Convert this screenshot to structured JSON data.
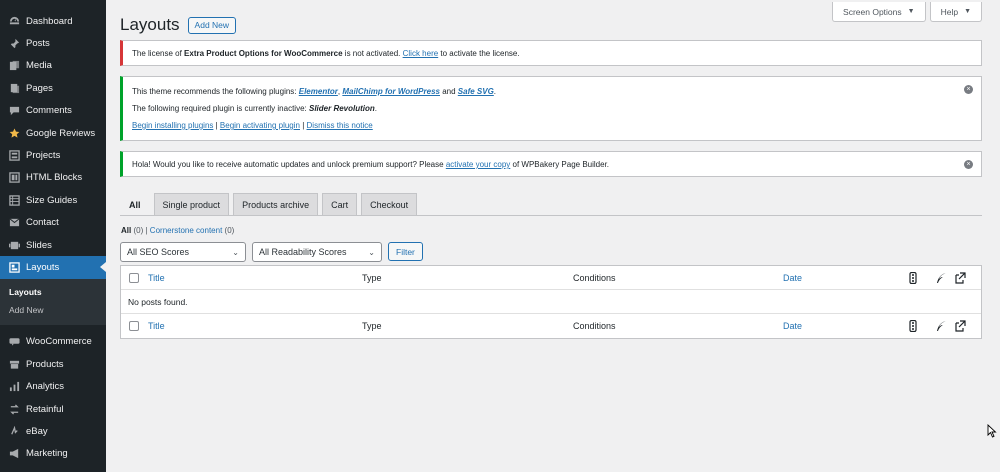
{
  "sidebar": {
    "items": [
      {
        "label": "Dashboard",
        "icon": "dashboard-icon"
      },
      {
        "label": "Posts",
        "icon": "pin-icon"
      },
      {
        "label": "Media",
        "icon": "media-icon"
      },
      {
        "label": "Pages",
        "icon": "pages-icon"
      },
      {
        "label": "Comments",
        "icon": "comment-icon"
      },
      {
        "label": "Google Reviews",
        "icon": "star-icon"
      },
      {
        "label": "Projects",
        "icon": "portfolio-icon"
      },
      {
        "label": "HTML Blocks",
        "icon": "blocks-icon"
      },
      {
        "label": "Size Guides",
        "icon": "table-icon"
      },
      {
        "label": "Contact",
        "icon": "mail-icon"
      },
      {
        "label": "Slides",
        "icon": "slides-icon"
      },
      {
        "label": "Layouts",
        "icon": "layout-icon",
        "active": true
      }
    ],
    "submenu": [
      "Layouts",
      "Add New"
    ],
    "items2": [
      {
        "label": "WooCommerce",
        "icon": "woo-icon"
      },
      {
        "label": "Products",
        "icon": "archive-icon"
      },
      {
        "label": "Analytics",
        "icon": "chart-icon"
      },
      {
        "label": "Retainful",
        "icon": "retainful-icon"
      },
      {
        "label": "eBay",
        "icon": "ebay-icon"
      },
      {
        "label": "Marketing",
        "icon": "megaphone-icon"
      }
    ]
  },
  "top": {
    "screen_options": "Screen Options",
    "help": "Help"
  },
  "page": {
    "title": "Layouts",
    "add_new": "Add New"
  },
  "notices": {
    "license": {
      "pre": "The license of ",
      "product": "Extra Product Options for WooCommerce",
      "mid": " is not activated. ",
      "link": "Click here",
      "post": " to activate the license."
    },
    "theme": {
      "l1_pre": "This theme recommends the following plugins: ",
      "p1": "Elementor",
      "sep1": ", ",
      "p2": "MailChimp for WordPress",
      "and": " and ",
      "p3": "Safe SVG",
      "dot": ".",
      "l2_pre": "The following required plugin is currently inactive: ",
      "p4": "Slider Revolution",
      "link1": "Begin installing plugins",
      "pipe": " | ",
      "link2": "Begin activating plugin",
      "link3": "Dismiss this notice"
    },
    "wpbakery": {
      "pre": "Hola! Would you like to receive automatic updates and unlock premium support? Please ",
      "link": "activate your copy",
      "post": " of WPBakery Page Builder."
    }
  },
  "tabs": [
    "All",
    "Single product",
    "Products archive",
    "Cart",
    "Checkout"
  ],
  "views": {
    "all": "All",
    "all_count": "(0)",
    "sep": "|",
    "cornerstone": "Cornerstone content",
    "cornerstone_count": "(0)"
  },
  "filters": {
    "seo": "All SEO Scores",
    "readability": "All Readability Scores",
    "filter_btn": "Filter"
  },
  "table": {
    "columns": {
      "title": "Title",
      "type": "Type",
      "conditions": "Conditions",
      "date": "Date"
    },
    "empty": "No posts found."
  }
}
